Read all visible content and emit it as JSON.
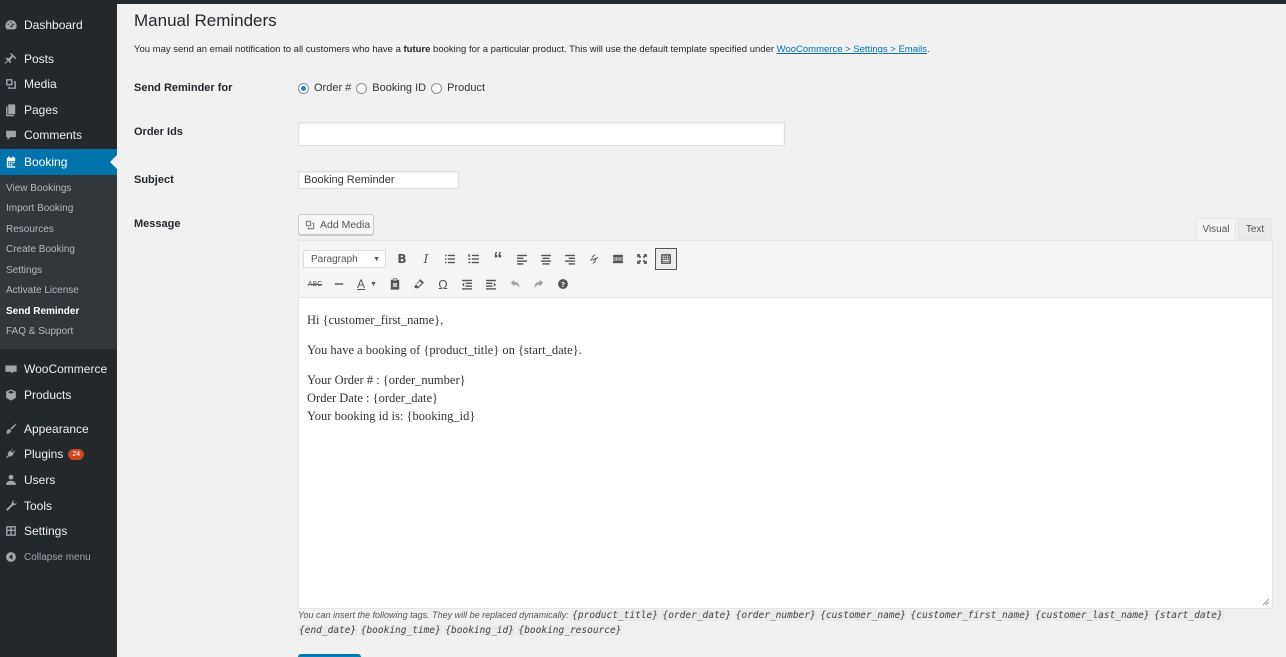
{
  "sidebar": {
    "main_top": [
      {
        "label": "Dashboard",
        "icon": "dashboard-icon"
      },
      {
        "label": "Posts",
        "icon": "pin-icon"
      },
      {
        "label": "Media",
        "icon": "media-icon"
      },
      {
        "label": "Pages",
        "icon": "pages-icon"
      },
      {
        "label": "Comments",
        "icon": "comments-icon"
      },
      {
        "label": "Booking",
        "icon": "calendar-icon"
      }
    ],
    "submenu": [
      "View Bookings",
      "Import Booking",
      "Resources",
      "Create Booking",
      "Settings",
      "Activate License",
      "Send Reminder",
      "FAQ & Support"
    ],
    "main_bottom": [
      {
        "label": "WooCommerce",
        "icon": "woocommerce-icon"
      },
      {
        "label": "Products",
        "icon": "products-icon"
      },
      {
        "label": "Appearance",
        "icon": "brush-icon"
      },
      {
        "label": "Plugins",
        "icon": "plugin-icon"
      },
      {
        "label": "Users",
        "icon": "users-icon"
      },
      {
        "label": "Tools",
        "icon": "wrench-icon"
      },
      {
        "label": "Settings",
        "icon": "settings-icon"
      }
    ],
    "plugins_badge": "24",
    "collapse_label": "Collapse menu"
  },
  "page": {
    "title": "Manual Reminders",
    "intro_pre": "You may send an email notification to all customers who have a ",
    "intro_bold": "future",
    "intro_mid": " booking for a particular product. This will use the default template specified under ",
    "intro_link": "WooCommerce > Settings > Emails",
    "intro_end": "."
  },
  "form": {
    "send_reminder_label": "Send Reminder for",
    "radio_options": [
      "Order #",
      "Booking ID",
      "Product"
    ],
    "selected_option": "Order #",
    "order_ids_label": "Order Ids",
    "order_ids_value": "",
    "subject_label": "Subject",
    "subject_value": "Booking Reminder",
    "message_label": "Message",
    "add_media_label": "Add Media",
    "tab_visual": "Visual",
    "tab_text": "Text",
    "format_select": "Paragraph"
  },
  "message": {
    "greeting": "Hi {customer_first_name},",
    "line2": "You have a booking of {product_title} on {start_date}.",
    "line3": "Your Order # : {order_number}",
    "line4": "Order Date : {order_date}",
    "line5": "Your booking id is: {booking_id}"
  },
  "tags_note": {
    "text": "You can insert the following tags. They will be replaced dynamically:",
    "tags": [
      "{product_title}",
      "{order_date}",
      "{order_number}",
      "{customer_name}",
      "{customer_first_name}",
      "{customer_last_name}",
      "{start_date}",
      "{end_date}",
      "{booking_time}",
      "{booking_id}",
      "{booking_resource}"
    ]
  },
  "colors": {
    "sidebar_bg": "#23282d",
    "submenu_bg": "#32373c",
    "accent": "#0073aa",
    "badge": "#ca4a1f"
  }
}
